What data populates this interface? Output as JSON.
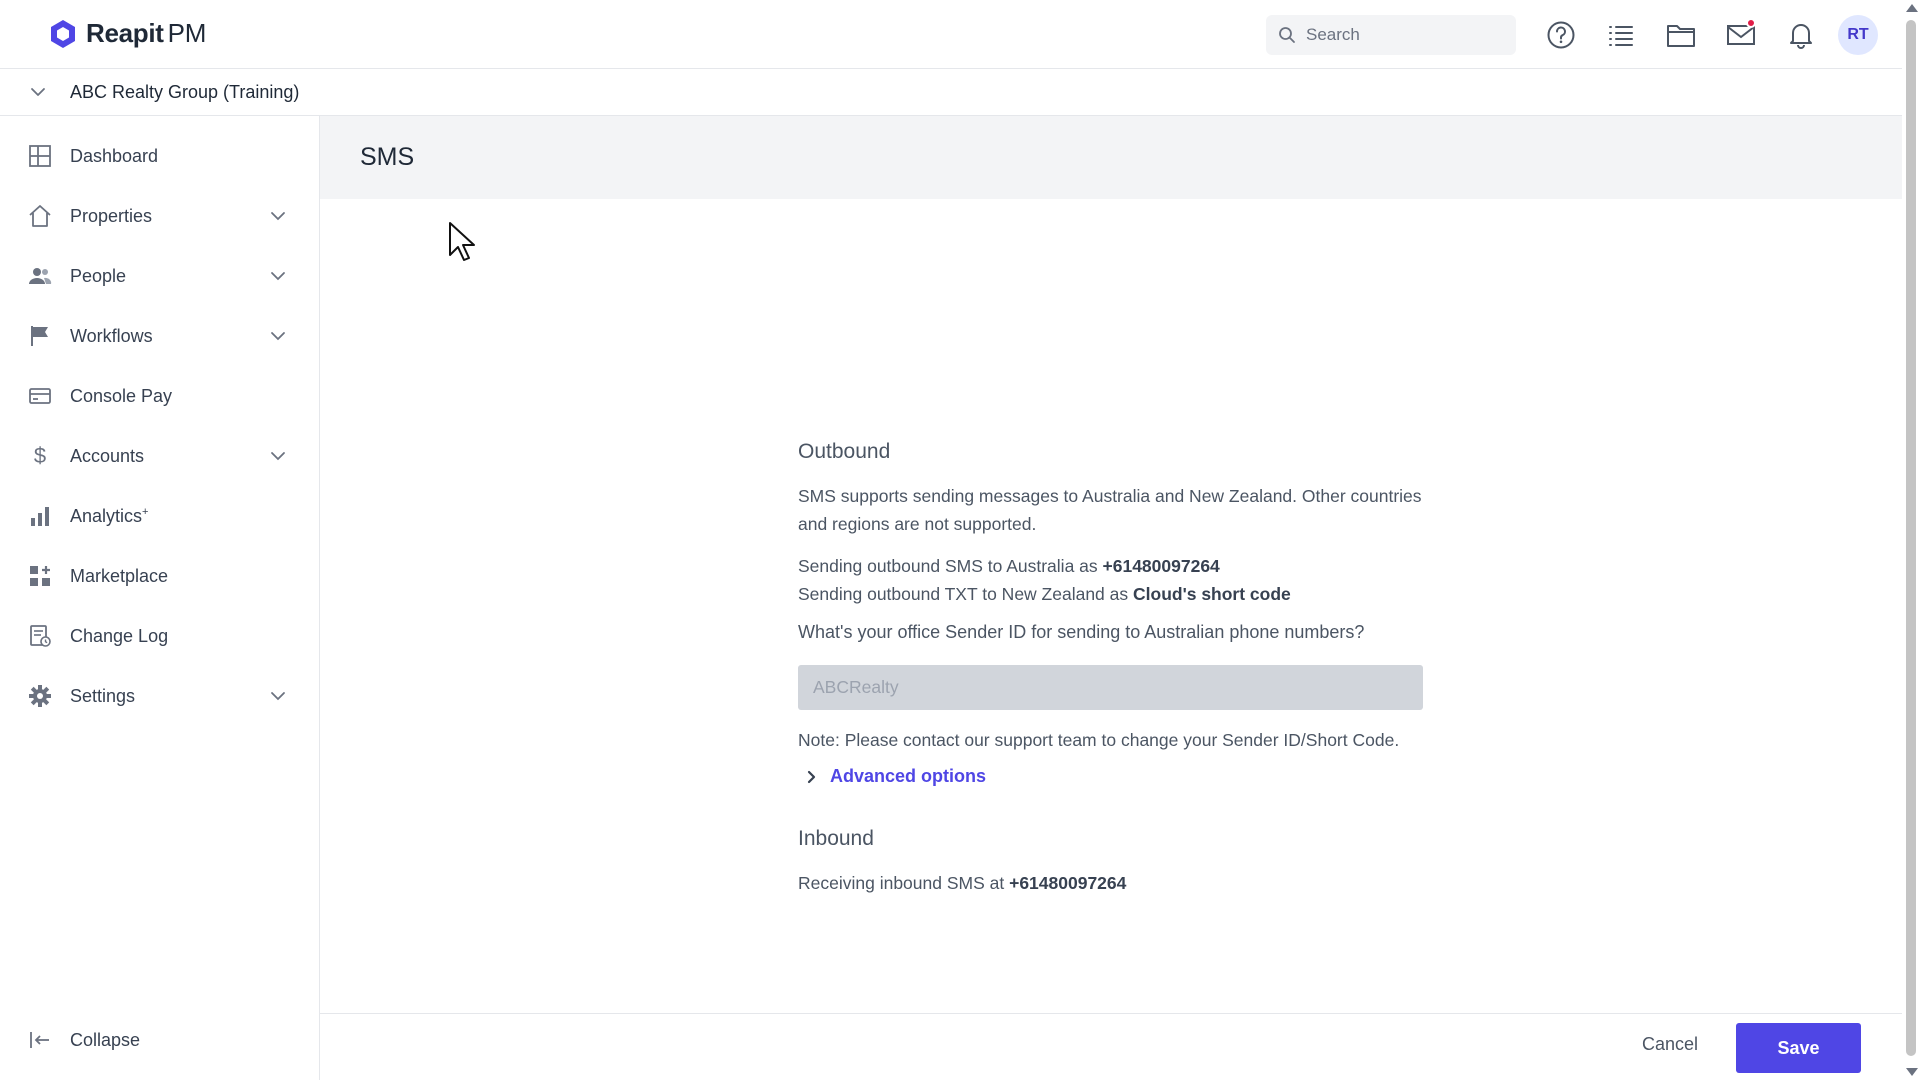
{
  "header": {
    "brand": "Reapit",
    "product": "PM",
    "search_placeholder": "Search",
    "avatar_initials": "RT",
    "accent_color": "#4f46e5",
    "notification_color": "#e11d48"
  },
  "org": {
    "name": "ABC Realty Group (Training)"
  },
  "sidebar": {
    "items": [
      {
        "label": "Dashboard",
        "icon": "dashboard-icon",
        "expandable": false
      },
      {
        "label": "Properties",
        "icon": "home-icon",
        "expandable": true
      },
      {
        "label": "People",
        "icon": "people-icon",
        "expandable": true
      },
      {
        "label": "Workflows",
        "icon": "flag-icon",
        "expandable": true
      },
      {
        "label": "Console Pay",
        "icon": "card-icon",
        "expandable": false
      },
      {
        "label": "Accounts",
        "icon": "dollar-icon",
        "expandable": true
      },
      {
        "label": "Analytics",
        "icon": "bar-chart-icon",
        "expandable": false,
        "suffix": "+"
      },
      {
        "label": "Marketplace",
        "icon": "apps-icon",
        "expandable": false
      },
      {
        "label": "Change Log",
        "icon": "changelog-icon",
        "expandable": false
      },
      {
        "label": "Settings",
        "icon": "gear-icon",
        "expandable": true
      }
    ],
    "collapse_label": "Collapse"
  },
  "page": {
    "title": "SMS"
  },
  "outbound": {
    "title": "Outbound",
    "description": "SMS supports sending messages to Australia and New Zealand. Other countries and regions are not supported.",
    "au_prefix": "Sending outbound SMS to Australia as ",
    "au_number": "+61480097264",
    "nz_prefix": "Sending outbound TXT to New Zealand as ",
    "nz_value": "Cloud's short code",
    "question": "What's your office Sender ID for sending to Australian phone numbers?",
    "sender_id": "ABCRealty",
    "note": "Note: Please contact our support team to change your Sender ID/Short Code.",
    "advanced_label": "Advanced options"
  },
  "inbound": {
    "title": "Inbound",
    "prefix": "Receiving inbound SMS at ",
    "number": "+61480097264"
  },
  "footer": {
    "cancel_label": "Cancel",
    "save_label": "Save"
  }
}
